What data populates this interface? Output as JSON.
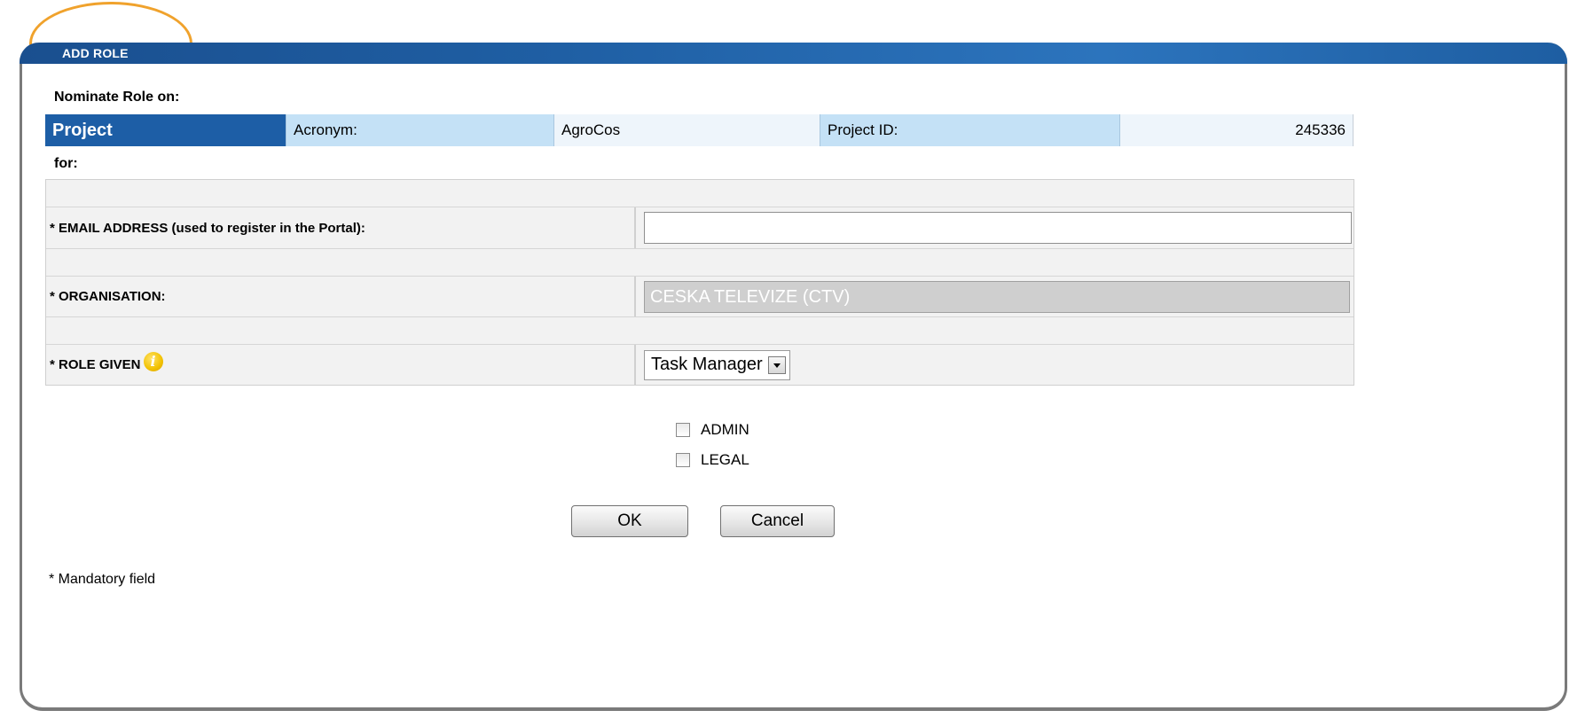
{
  "dialog": {
    "title": "ADD ROLE",
    "nominate_label": "Nominate Role on:",
    "for_label": "for:",
    "mandatory_note": "* Mandatory field"
  },
  "project": {
    "type_label": "Project",
    "acronym_label": "Acronym:",
    "acronym_value": "AgroCos",
    "id_label": "Project ID:",
    "id_value": "245336"
  },
  "form": {
    "email": {
      "label": "* EMAIL ADDRESS (used to register in the Portal):",
      "value": ""
    },
    "organisation": {
      "label": "* ORGANISATION:",
      "value": "CESKA TELEVIZE (CTV)"
    },
    "role": {
      "label": "* ROLE GIVEN",
      "selected": "Task Manager",
      "info_icon": "i"
    }
  },
  "options": [
    {
      "label": "ADMIN",
      "checked": false
    },
    {
      "label": "LEGAL",
      "checked": false
    }
  ],
  "buttons": {
    "ok_label": "OK",
    "cancel_label": "Cancel"
  },
  "colors": {
    "header_blue": "#1f5fa4",
    "project_cell_blue": "#1d5ea6",
    "label_cell_light_blue": "#c4e1f6",
    "highlight_orange": "#f0a22c"
  }
}
